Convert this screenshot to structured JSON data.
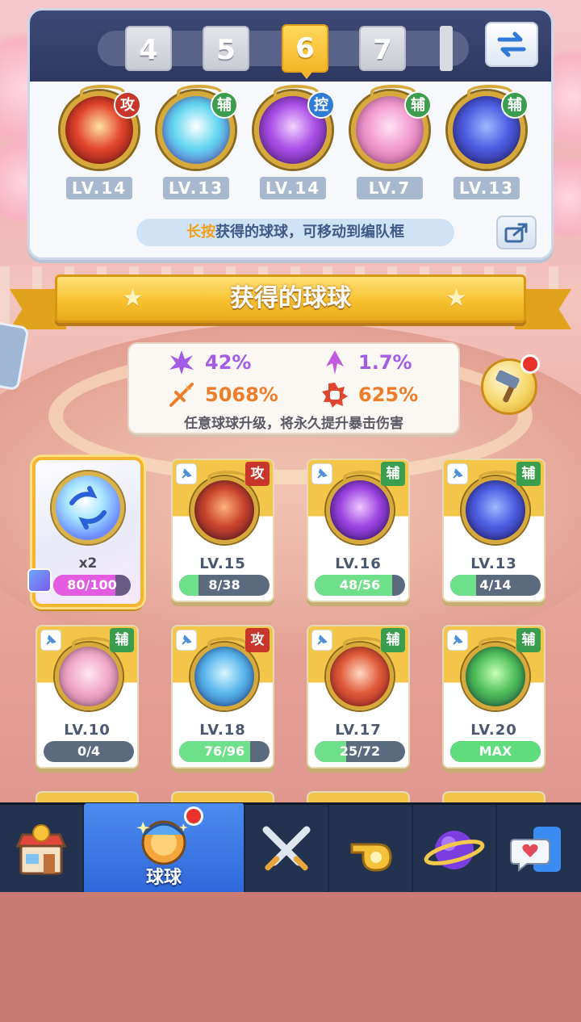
{
  "team_tabs": [
    "4",
    "5",
    "6",
    "7"
  ],
  "active_tab": "6",
  "team_slots": [
    {
      "role": "攻",
      "level": "LV.14",
      "colors": [
        "#ffe2a0",
        "#e2452c",
        "#7a1418"
      ]
    },
    {
      "role": "辅",
      "level": "LV.13",
      "colors": [
        "#ffffff",
        "#62d6f0",
        "#6a52d8"
      ]
    },
    {
      "role": "控",
      "level": "LV.14",
      "colors": [
        "#f3d2ff",
        "#a94ee6",
        "#5a208c"
      ]
    },
    {
      "role": "辅",
      "level": "LV.7",
      "colors": [
        "#ffe3f2",
        "#f29ad0",
        "#c05a9e"
      ]
    },
    {
      "role": "辅",
      "level": "LV.13",
      "colors": [
        "#9fb8ff",
        "#4b5de0",
        "#2a1f78"
      ]
    }
  ],
  "hint": {
    "highlight": "长按",
    "text": "获得的球球，可移动到编队框"
  },
  "section_title": "获得的球球",
  "stats": {
    "purple_1": "42%",
    "purple_2": "1.7%",
    "orange_1": "5068%",
    "orange_2": "625%",
    "note": "任意球球升级，将永久提升暴击伤害"
  },
  "special_card": {
    "count": "x2",
    "progress": "80/100",
    "fraction": 0.8
  },
  "cards": [
    {
      "role": "攻",
      "level": "LV.15",
      "progress": "8/38",
      "fraction": 0.21,
      "colors": [
        "#ffb17a",
        "#c8432c",
        "#5a1a30"
      ]
    },
    {
      "role": "辅",
      "level": "LV.16",
      "progress": "48/56",
      "fraction": 0.86,
      "colors": [
        "#f0c8ff",
        "#9b43e0",
        "#3b1680"
      ]
    },
    {
      "role": "辅",
      "level": "LV.13",
      "progress": "4/14",
      "fraction": 0.29,
      "colors": [
        "#9fb8ff",
        "#4b5de0",
        "#2a1f78"
      ]
    },
    {
      "role": "辅",
      "level": "LV.10",
      "progress": "0/4",
      "fraction": 0,
      "colors": [
        "#ffe6f0",
        "#f0a8c8",
        "#b86a90"
      ]
    },
    {
      "role": "攻",
      "level": "LV.18",
      "progress": "76/96",
      "fraction": 0.79,
      "colors": [
        "#d8f6ff",
        "#5ab6ec",
        "#2456b0"
      ]
    },
    {
      "role": "辅",
      "level": "LV.17",
      "progress": "25/72",
      "fraction": 0.35,
      "colors": [
        "#ffd9c2",
        "#e05a3a",
        "#9c1e24"
      ]
    },
    {
      "role": "辅",
      "level": "LV.20",
      "progress": "MAX",
      "fraction": 1,
      "colors": [
        "#c8ffb8",
        "#4fbf5a",
        "#1d5c4a"
      ]
    }
  ],
  "nav": [
    {
      "icon": "shop-icon",
      "label": ""
    },
    {
      "icon": "ball-icon",
      "label": "球球"
    },
    {
      "icon": "crossed-swords-icon",
      "label": ""
    },
    {
      "icon": "whistle-icon",
      "label": ""
    },
    {
      "icon": "planet-icon",
      "label": ""
    },
    {
      "icon": "chat-heart-icon",
      "label": ""
    }
  ]
}
